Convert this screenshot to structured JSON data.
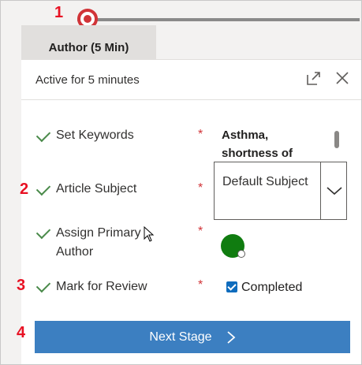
{
  "stage": {
    "label": "Author  (5 Min)"
  },
  "callouts": [
    "1",
    "2",
    "3",
    "4"
  ],
  "panel": {
    "title": "Active for 5 minutes",
    "expand_icon": "expand-icon",
    "close_icon": "close-icon"
  },
  "steps": [
    {
      "label": "Set Keywords",
      "required": "*",
      "value": "Asthma, shortness of",
      "status": "completed"
    },
    {
      "label": "Article Subject",
      "required": "*",
      "value": "Default Subject",
      "status": "completed"
    },
    {
      "label": "Assign Primary Author",
      "required": "*",
      "value": "",
      "status": "completed"
    },
    {
      "label": "Mark for Review",
      "required": "*",
      "value": "Completed",
      "checked": true,
      "status": "completed"
    }
  ],
  "next_button": {
    "label": "Next Stage"
  },
  "colors": {
    "accent": "#3c7fc1",
    "callout": "#e81123",
    "stage_marker": "#d13438",
    "check": "#4a8a4a",
    "avatar": "#107c10"
  }
}
